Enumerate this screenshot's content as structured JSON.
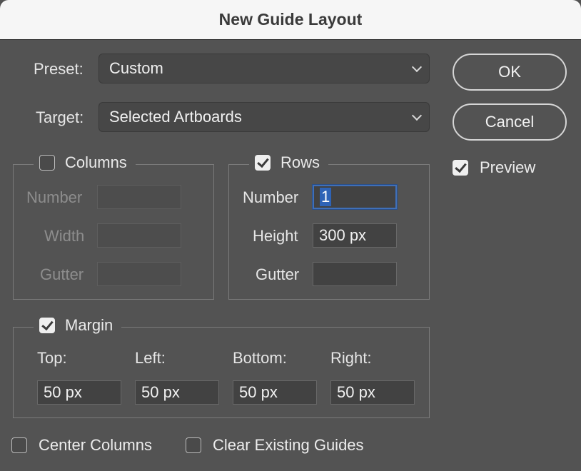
{
  "window": {
    "title": "New Guide Layout"
  },
  "preset": {
    "label": "Preset:",
    "value": "Custom"
  },
  "target": {
    "label": "Target:",
    "value": "Selected Artboards"
  },
  "buttons": {
    "ok": "OK",
    "cancel": "Cancel"
  },
  "preview": {
    "label": "Preview",
    "checked": true
  },
  "columns": {
    "label": "Columns",
    "checked": false,
    "number_label": "Number",
    "width_label": "Width",
    "gutter_label": "Gutter",
    "number": "",
    "width": "",
    "gutter": ""
  },
  "rows": {
    "label": "Rows",
    "checked": true,
    "number_label": "Number",
    "height_label": "Height",
    "gutter_label": "Gutter",
    "number": "1",
    "height": "300 px",
    "gutter": ""
  },
  "margin": {
    "label": "Margin",
    "checked": true,
    "top_label": "Top:",
    "left_label": "Left:",
    "bottom_label": "Bottom:",
    "right_label": "Right:",
    "top": "50 px",
    "left": "50 px",
    "bottom": "50 px",
    "right": "50 px"
  },
  "options": {
    "center_columns": {
      "label": "Center Columns",
      "checked": false
    },
    "clear_existing": {
      "label": "Clear Existing Guides",
      "checked": false
    }
  },
  "colors": {
    "dialog_bg": "#535353",
    "titlebar_bg": "#f6f6f6",
    "focus": "#3f6fb8"
  }
}
